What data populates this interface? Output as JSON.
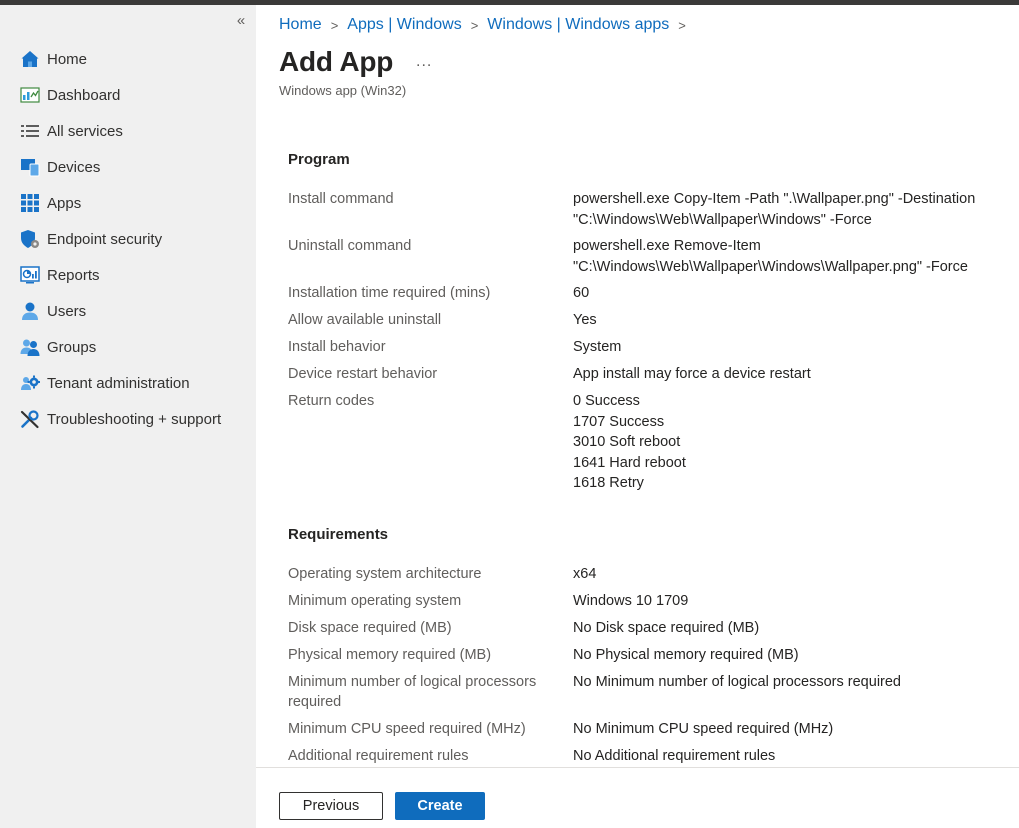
{
  "sidebar": {
    "collapse_glyph": "«",
    "items": [
      {
        "label": "Home",
        "icon": "home-icon"
      },
      {
        "label": "Dashboard",
        "icon": "dashboard-icon"
      },
      {
        "label": "All services",
        "icon": "list-icon"
      },
      {
        "label": "Devices",
        "icon": "devices-icon"
      },
      {
        "label": "Apps",
        "icon": "apps-grid-icon"
      },
      {
        "label": "Endpoint security",
        "icon": "shield-gear-icon"
      },
      {
        "label": "Reports",
        "icon": "reports-icon"
      },
      {
        "label": "Users",
        "icon": "user-icon"
      },
      {
        "label": "Groups",
        "icon": "groups-icon"
      },
      {
        "label": "Tenant administration",
        "icon": "tenant-gear-icon"
      },
      {
        "label": "Troubleshooting + support",
        "icon": "tools-icon"
      }
    ]
  },
  "breadcrumb": [
    "Home",
    "Apps | Windows",
    "Windows | Windows apps"
  ],
  "breadcrumb_sep": ">",
  "page": {
    "title": "Add App",
    "more": "...",
    "subtitle": "Windows app (Win32)"
  },
  "program": {
    "heading": "Program",
    "rows": [
      {
        "key": "Install command",
        "value": "powershell.exe Copy-Item -Path \".\\Wallpaper.png\" -Destination \"C:\\Windows\\Web\\Wallpaper\\Windows\" -Force"
      },
      {
        "key": "Uninstall command",
        "value": "powershell.exe Remove-Item \"C:\\Windows\\Web\\Wallpaper\\Windows\\Wallpaper.png\" -Force"
      },
      {
        "key": "Installation time required (mins)",
        "value": "60"
      },
      {
        "key": "Allow available uninstall",
        "value": "Yes"
      },
      {
        "key": "Install behavior",
        "value": "System"
      },
      {
        "key": "Device restart behavior",
        "value": "App install may force a device restart"
      },
      {
        "key": "Return codes",
        "value": [
          "0 Success",
          "1707 Success",
          "3010 Soft reboot",
          "1641 Hard reboot",
          "1618 Retry"
        ]
      }
    ]
  },
  "requirements": {
    "heading": "Requirements",
    "rows": [
      {
        "key": "Operating system architecture",
        "value": "x64"
      },
      {
        "key": "Minimum operating system",
        "value": "Windows 10 1709"
      },
      {
        "key": "Disk space required (MB)",
        "value": "No Disk space required (MB)"
      },
      {
        "key": "Physical memory required (MB)",
        "value": "No Physical memory required (MB)"
      },
      {
        "key": "Minimum number of logical processors required",
        "value": "No Minimum number of logical processors required"
      },
      {
        "key": "Minimum CPU speed required (MHz)",
        "value": "No Minimum CPU speed required (MHz)"
      },
      {
        "key": "Additional requirement rules",
        "value": "No Additional requirement rules"
      }
    ]
  },
  "footer": {
    "previous_label": "Previous",
    "create_label": "Create"
  },
  "colors": {
    "accent": "#0f6cbd",
    "sidebar_bg": "#f0f0f0",
    "muted_text": "#605e5c"
  }
}
